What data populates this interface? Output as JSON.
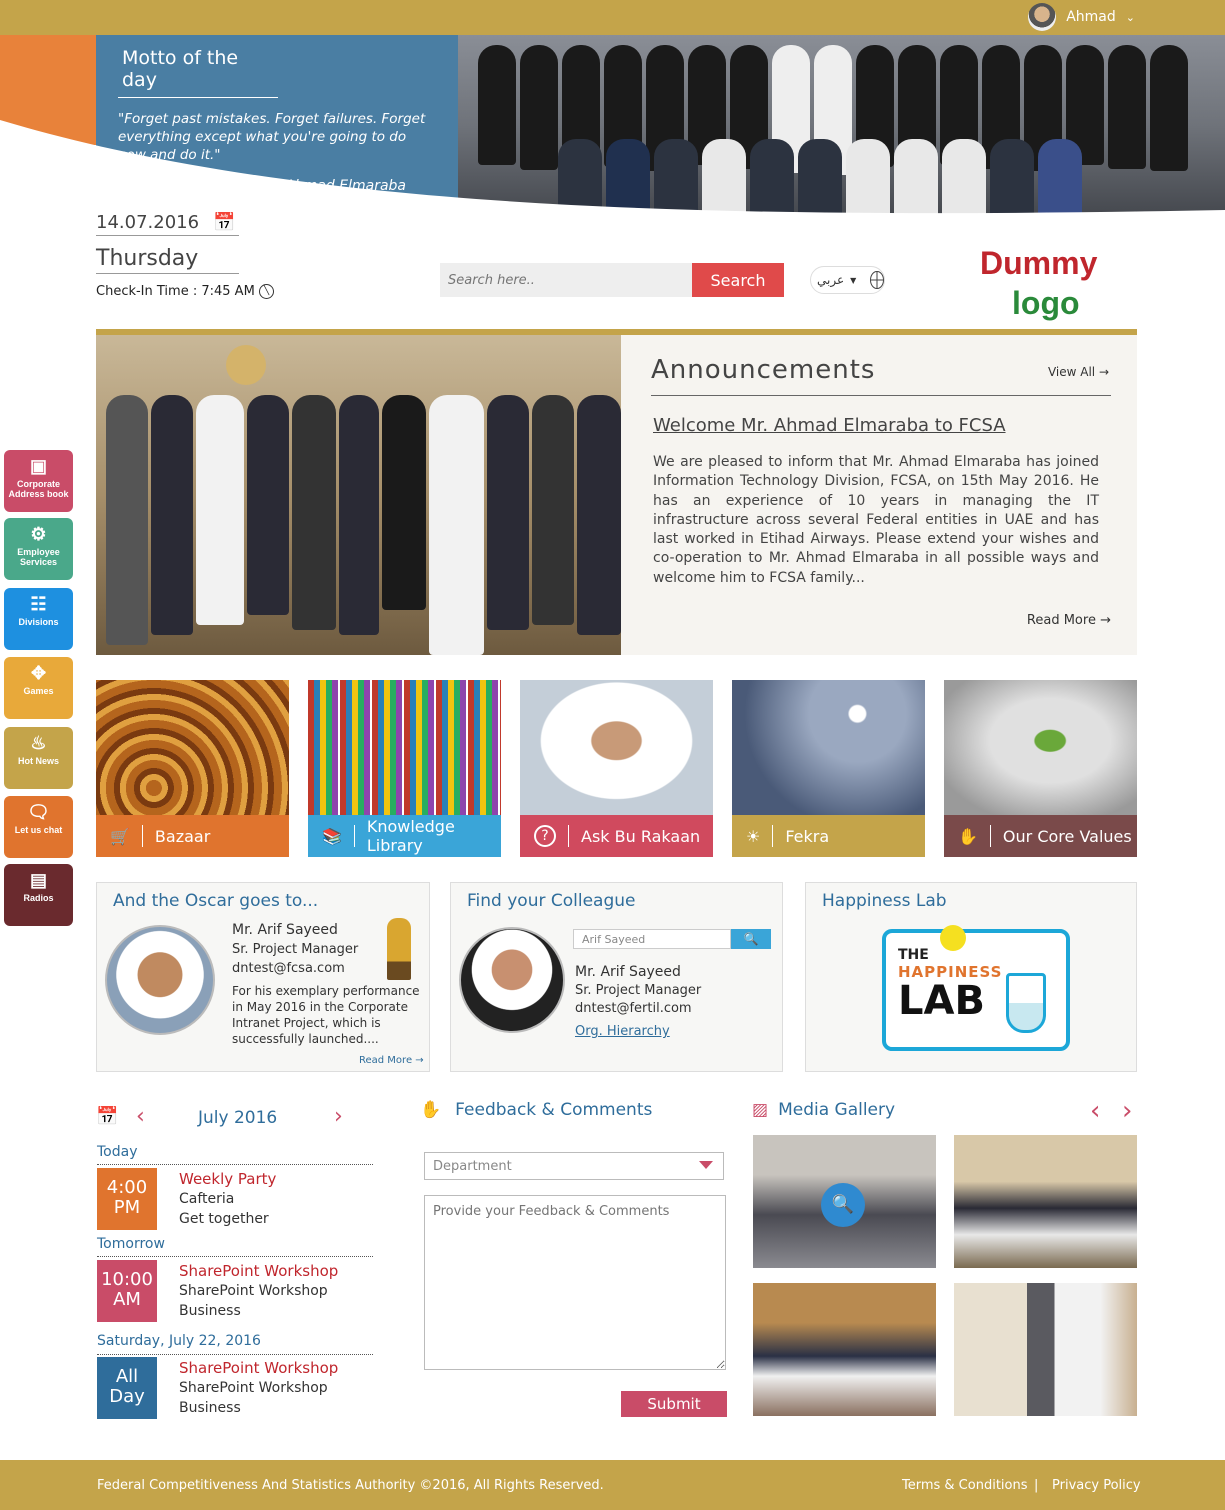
{
  "user": {
    "name": "Ahmad"
  },
  "motto": {
    "title": "Motto of the day",
    "quote": "\"Forget past mistakes. Forget failures. Forget everything except what you're going to do now and do it.\"",
    "author": "-Ahmad Elmaraba"
  },
  "date": {
    "date": "14.07.2016",
    "day": "Thursday",
    "checkin": "Check-In Time : 7:45 AM"
  },
  "search": {
    "placeholder": "Search here..",
    "button": "Search"
  },
  "language": {
    "label": "عربي"
  },
  "logo": {
    "line1": "Dummy",
    "line2": "logo"
  },
  "announcements": {
    "title": "Announcements",
    "view_all": "View All",
    "headline": "Welcome Mr. Ahmad Elmaraba to FCSA",
    "body": "We are pleased to inform that Mr. Ahmad Elmaraba has joined Information Technology Division, FCSA, on 15th May 2016. He has an experience of 10 years in managing the IT infrastructure across several Federal entities in UAE and has last worked in Etihad Airways. Please extend your wishes and co-operation to Mr. Ahmad Elmaraba in all possible ways and welcome him to FCSA family...",
    "read_more": "Read More"
  },
  "sidebar": [
    {
      "label": "Corporate Address book",
      "color": "#c94c68"
    },
    {
      "label": "Employee Services",
      "color": "#4aa88a"
    },
    {
      "label": "Divisions",
      "color": "#1e90e0"
    },
    {
      "label": "Games",
      "color": "#e8a93a"
    },
    {
      "label": "Hot News",
      "color": "#c4a44a"
    },
    {
      "label": "Let us chat",
      "color": "#e0742e"
    },
    {
      "label": "Radios",
      "color": "#6a2a2e"
    }
  ],
  "tiles": [
    {
      "label": "Bazaar",
      "color": "#e0742e"
    },
    {
      "label": "Knowledge Library",
      "color": "#3aa5d8"
    },
    {
      "label": "Ask Bu Rakaan",
      "color": "#d04a5e"
    },
    {
      "label": "Fekra",
      "color": "#c4a44a"
    },
    {
      "label": "Our Core Values",
      "color": "#7a4a4a"
    }
  ],
  "oscar": {
    "title": "And the Oscar goes to...",
    "name": "Mr. Arif Sayeed",
    "role": "Sr. Project Manager",
    "email": "dntest@fcsa.com",
    "desc": "For his exemplary performance in May 2016 in the Corporate Intranet Project, which is successfully launched....",
    "read_more": "Read More"
  },
  "colleague": {
    "title": "Find your Colleague",
    "search_value": "Arif Sayeed",
    "name": "Mr. Arif Sayeed",
    "role": "Sr. Project Manager",
    "email": "dntest@fertil.com",
    "link": "Org. Hierarchy"
  },
  "happiness": {
    "title": "Happiness Lab",
    "logo_the": "THE",
    "logo_happiness": "HAPPINESS",
    "logo_lab": "LAB"
  },
  "calendar": {
    "month": "July 2016",
    "groups": [
      {
        "day": "Today",
        "time": "4:00 PM",
        "title": "Weekly Party",
        "line1": "Cafteria",
        "line2": "Get together",
        "color": "#e0742e"
      },
      {
        "day": "Tomorrow",
        "time": "10:00 AM",
        "title": "SharePoint Workshop",
        "line1": "SharePoint Workshop",
        "line2": "Business",
        "color": "#c94c68"
      },
      {
        "day": "Saturday, July 22, 2016",
        "time": "All Day",
        "title": "SharePoint Workshop",
        "line1": "SharePoint Workshop",
        "line2": "Business",
        "color": "#2f6d9b"
      }
    ]
  },
  "feedback": {
    "title": "Feedback & Comments",
    "department_placeholder": "Department",
    "comments_placeholder": "Provide your Feedback & Comments",
    "submit": "Submit"
  },
  "gallery": {
    "title": "Media Gallery"
  },
  "footer": {
    "copyright": "Federal Competitiveness And Statistics Authority ©2016, All Rights Reserved.",
    "terms": "Terms & Conditions",
    "privacy": "Privacy Policy"
  }
}
